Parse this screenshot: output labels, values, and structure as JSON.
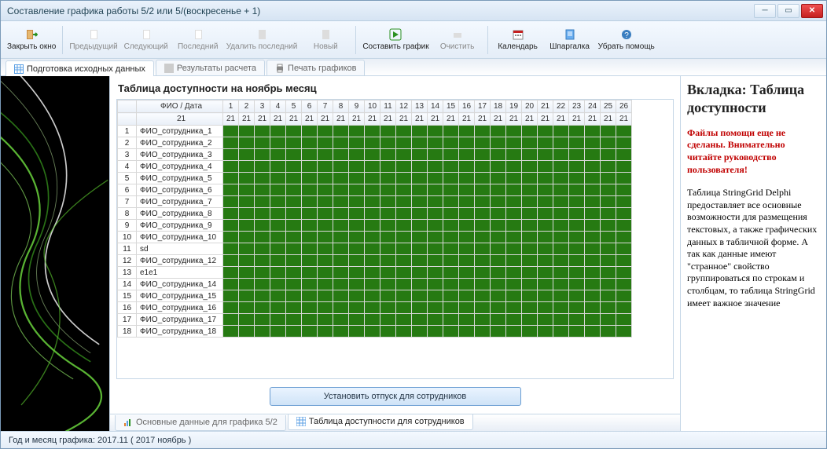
{
  "window": {
    "title": "Составление графика работы 5/2 или 5/(воскресенье + 1)"
  },
  "toolbar": {
    "close": "Закрыть окно",
    "prev": "Предыдущий",
    "next": "Следующий",
    "last": "Последний",
    "del_last": "Удалить последний",
    "new": "Новый",
    "compose": "Составить график",
    "clear": "Очистить",
    "calendar": "Календарь",
    "cheatsheet": "Шпаргалка",
    "hide_help": "Убрать помощь"
  },
  "tabs_top": {
    "prepare": "Подготовка исходных данных",
    "results": "Результаты расчета",
    "print": "Печать графиков"
  },
  "grid": {
    "title": "Таблица доступности на ноябрь месяц",
    "header_fio": "ФИО / Дата",
    "days": [
      1,
      2,
      3,
      4,
      5,
      6,
      7,
      8,
      9,
      10,
      11,
      12,
      13,
      14,
      15,
      16,
      17,
      18,
      19,
      20,
      21,
      22,
      23,
      24,
      25,
      26
    ],
    "sub": "21",
    "rows": [
      {
        "n": 1,
        "name": "ФИО_сотрудника_1"
      },
      {
        "n": 2,
        "name": "ФИО_сотрудника_2"
      },
      {
        "n": 3,
        "name": "ФИО_сотрудника_3"
      },
      {
        "n": 4,
        "name": "ФИО_сотрудника_4"
      },
      {
        "n": 5,
        "name": "ФИО_сотрудника_5"
      },
      {
        "n": 6,
        "name": "ФИО_сотрудника_6"
      },
      {
        "n": 7,
        "name": "ФИО_сотрудника_7"
      },
      {
        "n": 8,
        "name": "ФИО_сотрудника_8"
      },
      {
        "n": 9,
        "name": "ФИО_сотрудника_9"
      },
      {
        "n": 10,
        "name": "ФИО_сотрудника_10"
      },
      {
        "n": 11,
        "name": "sd"
      },
      {
        "n": 12,
        "name": "ФИО_сотрудника_12"
      },
      {
        "n": 13,
        "name": "e1e1"
      },
      {
        "n": 14,
        "name": "ФИО_сотрудника_14"
      },
      {
        "n": 15,
        "name": "ФИО_сотрудника_15"
      },
      {
        "n": 16,
        "name": "ФИО_сотрудника_16"
      },
      {
        "n": 17,
        "name": "ФИО_сотрудника_17"
      },
      {
        "n": 18,
        "name": "ФИО_сотрудника_18"
      }
    ],
    "button": "Установить отпуск для сотрудников"
  },
  "tabs_bottom": {
    "main": "Основные данные для графика 5/2",
    "avail": "Таблица доступности для сотрудников"
  },
  "help": {
    "heading": "Вкладка: Таблица доступности",
    "warn": "Файлы помощи еще не сделаны. Внимательно читайте руководство пользователя!",
    "body": "Таблица StringGrid Delphi предоставляет все основные возможности для размещения текстовых, а также графических данных в табличной форме. А так как данные имеют \"странное\" свойство группироваться по строкам и столбцам, то таблица StringGrid имеет важное значение"
  },
  "status": {
    "text": "Год и месяц графика:  2017.11  ( 2017  ноябрь )"
  }
}
